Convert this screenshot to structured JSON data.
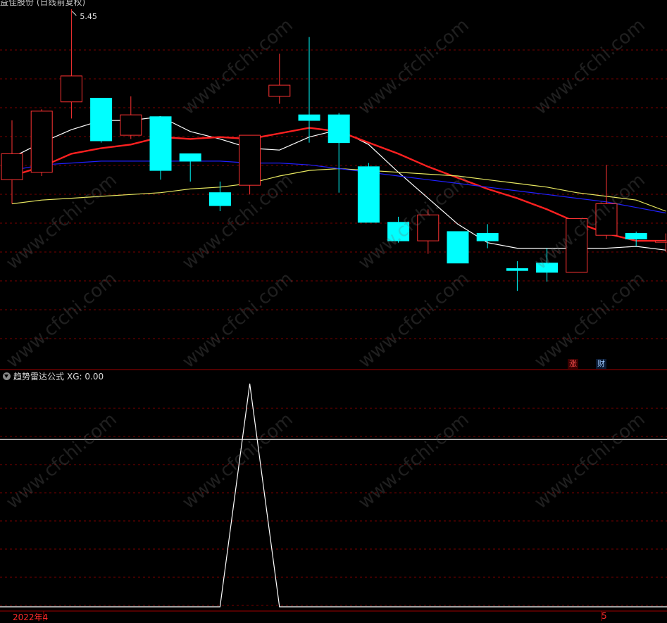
{
  "header": {
    "title_fragment": "益佳股份 (日线前复权)",
    "peak_label": "5.45"
  },
  "indicator": {
    "title": "趋势雷达公式",
    "readout": "XG: 0.00"
  },
  "tags": {
    "zhang": "涨",
    "cai": "财"
  },
  "x_axis": {
    "year_label": "2022年4",
    "month_label": "5"
  },
  "watermark": "www.cfchi.com",
  "colors": {
    "up_candle": "#ff3333",
    "down_candle": "#00ffff",
    "ma_white": "#ffffff",
    "ma_red": "#ff2020",
    "ma_yellow": "#e8e860",
    "ma_blue": "#2020ff",
    "grid": "#7a0000"
  },
  "chart_data": [
    {
      "type": "candlestick",
      "price_range": [
        3.6,
        5.5
      ],
      "candles": [
        {
          "o": 4.53,
          "h": 4.85,
          "l": 4.4,
          "c": 4.67
        },
        {
          "o": 4.57,
          "h": 4.91,
          "l": 4.55,
          "c": 4.9
        },
        {
          "o": 4.95,
          "h": 5.45,
          "l": 4.86,
          "c": 5.09
        },
        {
          "o": 4.97,
          "h": 4.97,
          "l": 4.73,
          "c": 4.74
        },
        {
          "o": 4.77,
          "h": 4.98,
          "l": 4.75,
          "c": 4.88
        },
        {
          "o": 4.87,
          "h": 4.87,
          "l": 4.53,
          "c": 4.58
        },
        {
          "o": 4.67,
          "h": 4.67,
          "l": 4.52,
          "c": 4.63
        },
        {
          "o": 4.46,
          "h": 4.52,
          "l": 4.36,
          "c": 4.39
        },
        {
          "o": 4.5,
          "h": 4.71,
          "l": 4.45,
          "c": 4.77
        },
        {
          "o": 4.98,
          "h": 5.21,
          "l": 4.94,
          "c": 5.04
        },
        {
          "o": 4.88,
          "h": 5.3,
          "l": 4.73,
          "c": 4.85
        },
        {
          "o": 4.88,
          "h": 4.89,
          "l": 4.46,
          "c": 4.73
        },
        {
          "o": 4.6,
          "h": 4.62,
          "l": 4.31,
          "c": 4.3
        },
        {
          "o": 4.3,
          "h": 4.33,
          "l": 4.19,
          "c": 4.2
        },
        {
          "o": 4.2,
          "h": 4.37,
          "l": 4.13,
          "c": 4.34
        },
        {
          "o": 4.25,
          "h": 4.25,
          "l": 4.1,
          "c": 4.08
        },
        {
          "o": 4.24,
          "h": 4.29,
          "l": 4.16,
          "c": 4.2
        },
        {
          "o": 4.05,
          "h": 4.09,
          "l": 3.93,
          "c": 4.04
        },
        {
          "o": 4.08,
          "h": 4.16,
          "l": 3.98,
          "c": 4.03
        },
        {
          "o": 4.03,
          "h": 4.29,
          "l": 4.04,
          "c": 4.32
        },
        {
          "o": 4.23,
          "h": 4.61,
          "l": 4.21,
          "c": 4.4
        },
        {
          "o": 4.24,
          "h": 4.25,
          "l": 4.17,
          "c": 4.21
        },
        {
          "o": 4.2,
          "h": 4.24,
          "l": 4.14,
          "c": 4.2
        }
      ],
      "series": [
        {
          "color": "white",
          "values": [
            4.65,
            4.73,
            4.8,
            4.85,
            4.85,
            4.87,
            4.79,
            4.75,
            4.7,
            4.69,
            4.76,
            4.8,
            4.72,
            4.57,
            4.43,
            4.29,
            4.19,
            4.16,
            4.16,
            4.16,
            4.16,
            4.17,
            4.15
          ]
        },
        {
          "color": "red",
          "values": [
            4.55,
            4.6,
            4.67,
            4.7,
            4.72,
            4.76,
            4.75,
            4.76,
            4.75,
            4.78,
            4.81,
            4.79,
            4.73,
            4.67,
            4.6,
            4.54,
            4.48,
            4.43,
            4.37,
            4.3,
            4.24,
            4.2,
            4.2
          ]
        },
        {
          "color": "yellow",
          "values": [
            4.4,
            4.42,
            4.43,
            4.44,
            4.45,
            4.46,
            4.48,
            4.49,
            4.51,
            4.55,
            4.58,
            4.59,
            4.58,
            4.57,
            4.56,
            4.55,
            4.53,
            4.51,
            4.49,
            4.46,
            4.44,
            4.42,
            4.36
          ]
        },
        {
          "color": "blue",
          "values": [
            4.58,
            4.61,
            4.62,
            4.63,
            4.63,
            4.63,
            4.63,
            4.63,
            4.62,
            4.62,
            4.61,
            4.59,
            4.57,
            4.55,
            4.53,
            4.51,
            4.49,
            4.47,
            4.45,
            4.43,
            4.41,
            4.38,
            4.35
          ]
        }
      ]
    },
    {
      "type": "line",
      "series": [
        {
          "values": [
            0,
            0,
            0,
            0,
            0,
            0,
            0,
            0,
            1,
            0,
            0,
            0,
            0,
            0,
            0,
            0,
            0,
            0,
            0,
            0,
            0,
            0,
            0
          ]
        }
      ],
      "reference_line": 0.75,
      "ylim": [
        0,
        1.0
      ]
    }
  ]
}
